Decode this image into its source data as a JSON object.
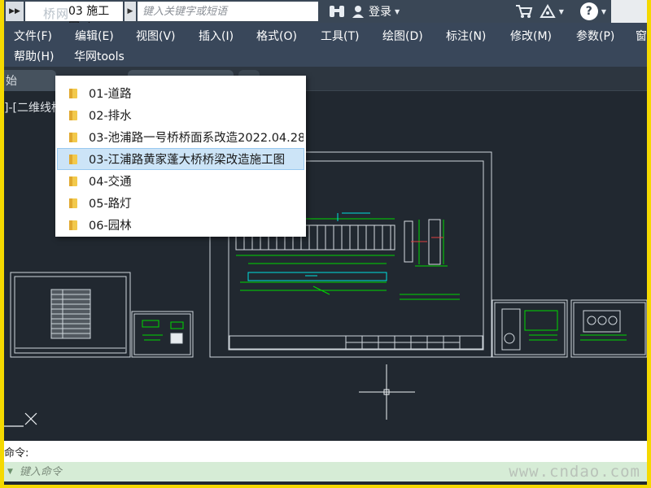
{
  "titlebar": {
    "logo_text": "桥网",
    "doc_title": "03 施工图.dwg",
    "search_placeholder": "键入关键字或短语",
    "login_label": "登录"
  },
  "menu": {
    "row1": [
      "文件(F)",
      "编辑(E)",
      "视图(V)",
      "插入(I)",
      "格式(O)",
      "工具(T)",
      "绘图(D)",
      "标注(N)",
      "修改(M)",
      "参数(P)",
      "窗"
    ],
    "row2": [
      "帮助(H)",
      "华网tools"
    ]
  },
  "tabs": {
    "start_label": "始"
  },
  "viewport": {
    "label": "]-[二维线框"
  },
  "popup": {
    "items": [
      "01-道路",
      "02-排水",
      "03-池浦路一号桥桥面系改造2022.04.28",
      "03-江浦路黄家蓬大桥桥梁改造施工图",
      "04-交通",
      "05-路灯",
      "06-园林"
    ],
    "selected_index": 3
  },
  "command": {
    "history_text": "命令:",
    "input_placeholder": "键入命令"
  },
  "watermark": "www.cndao.com",
  "colors": {
    "window_border": "#f5d900",
    "drawing_bg": "#212830",
    "titlebar_bg": "#3a4756",
    "menubar_bg": "#39475a",
    "selection_bg": "#cce4f7",
    "cad_green": "#00d800",
    "cad_cyan": "#00e0e0"
  }
}
